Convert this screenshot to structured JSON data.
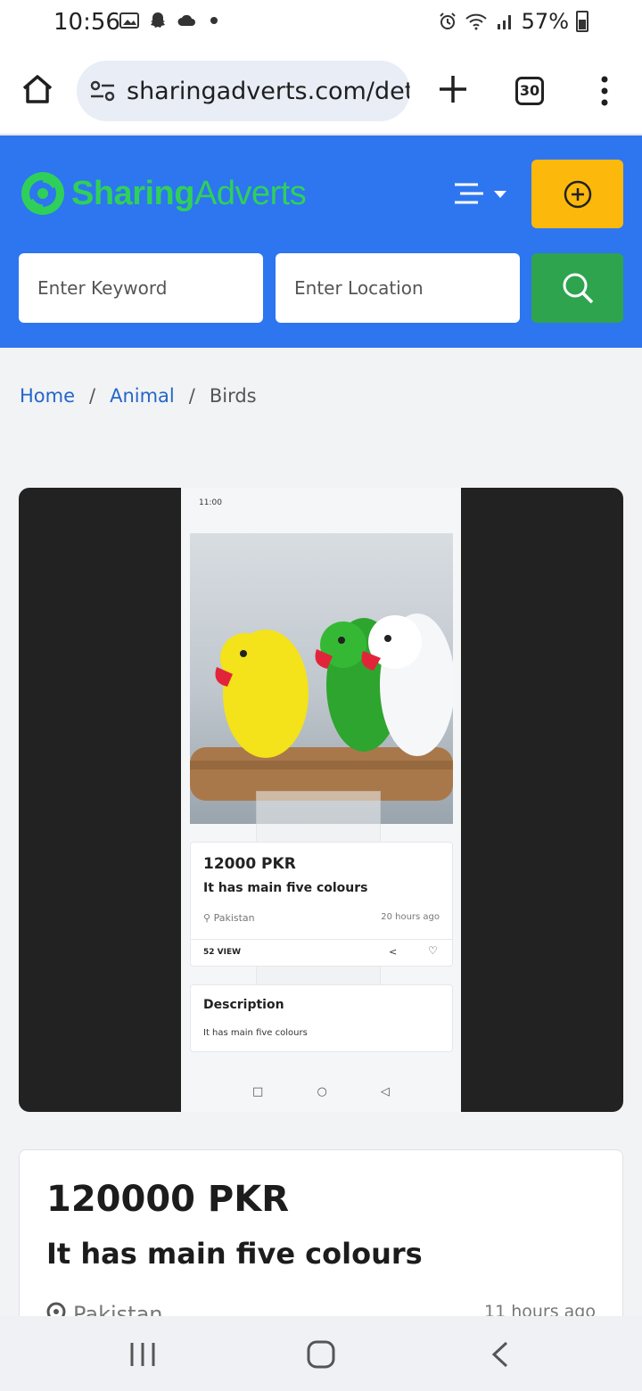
{
  "status_bar": {
    "time": "10:56",
    "battery": "57%"
  },
  "browser": {
    "url": "sharingadverts.com/det",
    "tab_count": "30",
    "icons": [
      "home-icon",
      "site-settings-icon",
      "new-tab-icon",
      "tab-switcher-icon",
      "more-vert-icon"
    ]
  },
  "site": {
    "logo_bold": "Sharing",
    "logo_light": "Adverts",
    "brand_color": "#2e75f0",
    "post_button_color": "#fdb80c",
    "search_button_color": "#2ea44f",
    "keyword_placeholder": "Enter Keyword",
    "location_placeholder": "Enter Location"
  },
  "breadcrumb": {
    "items": [
      "Home",
      "Animal",
      "Birds"
    ],
    "separator": "/"
  },
  "ad_image": {
    "status_time": "11:00",
    "price": "12000 PKR",
    "title": "It has main five colours",
    "location": "Pakistan",
    "posted": "20 hours ago",
    "views": "52 VIEW",
    "description_heading": "Description",
    "description_text": "It has main five colours"
  },
  "listing": {
    "price": "120000 PKR",
    "title": "It has main five colours",
    "location": "Pakistan",
    "posted": "11 hours ago"
  }
}
